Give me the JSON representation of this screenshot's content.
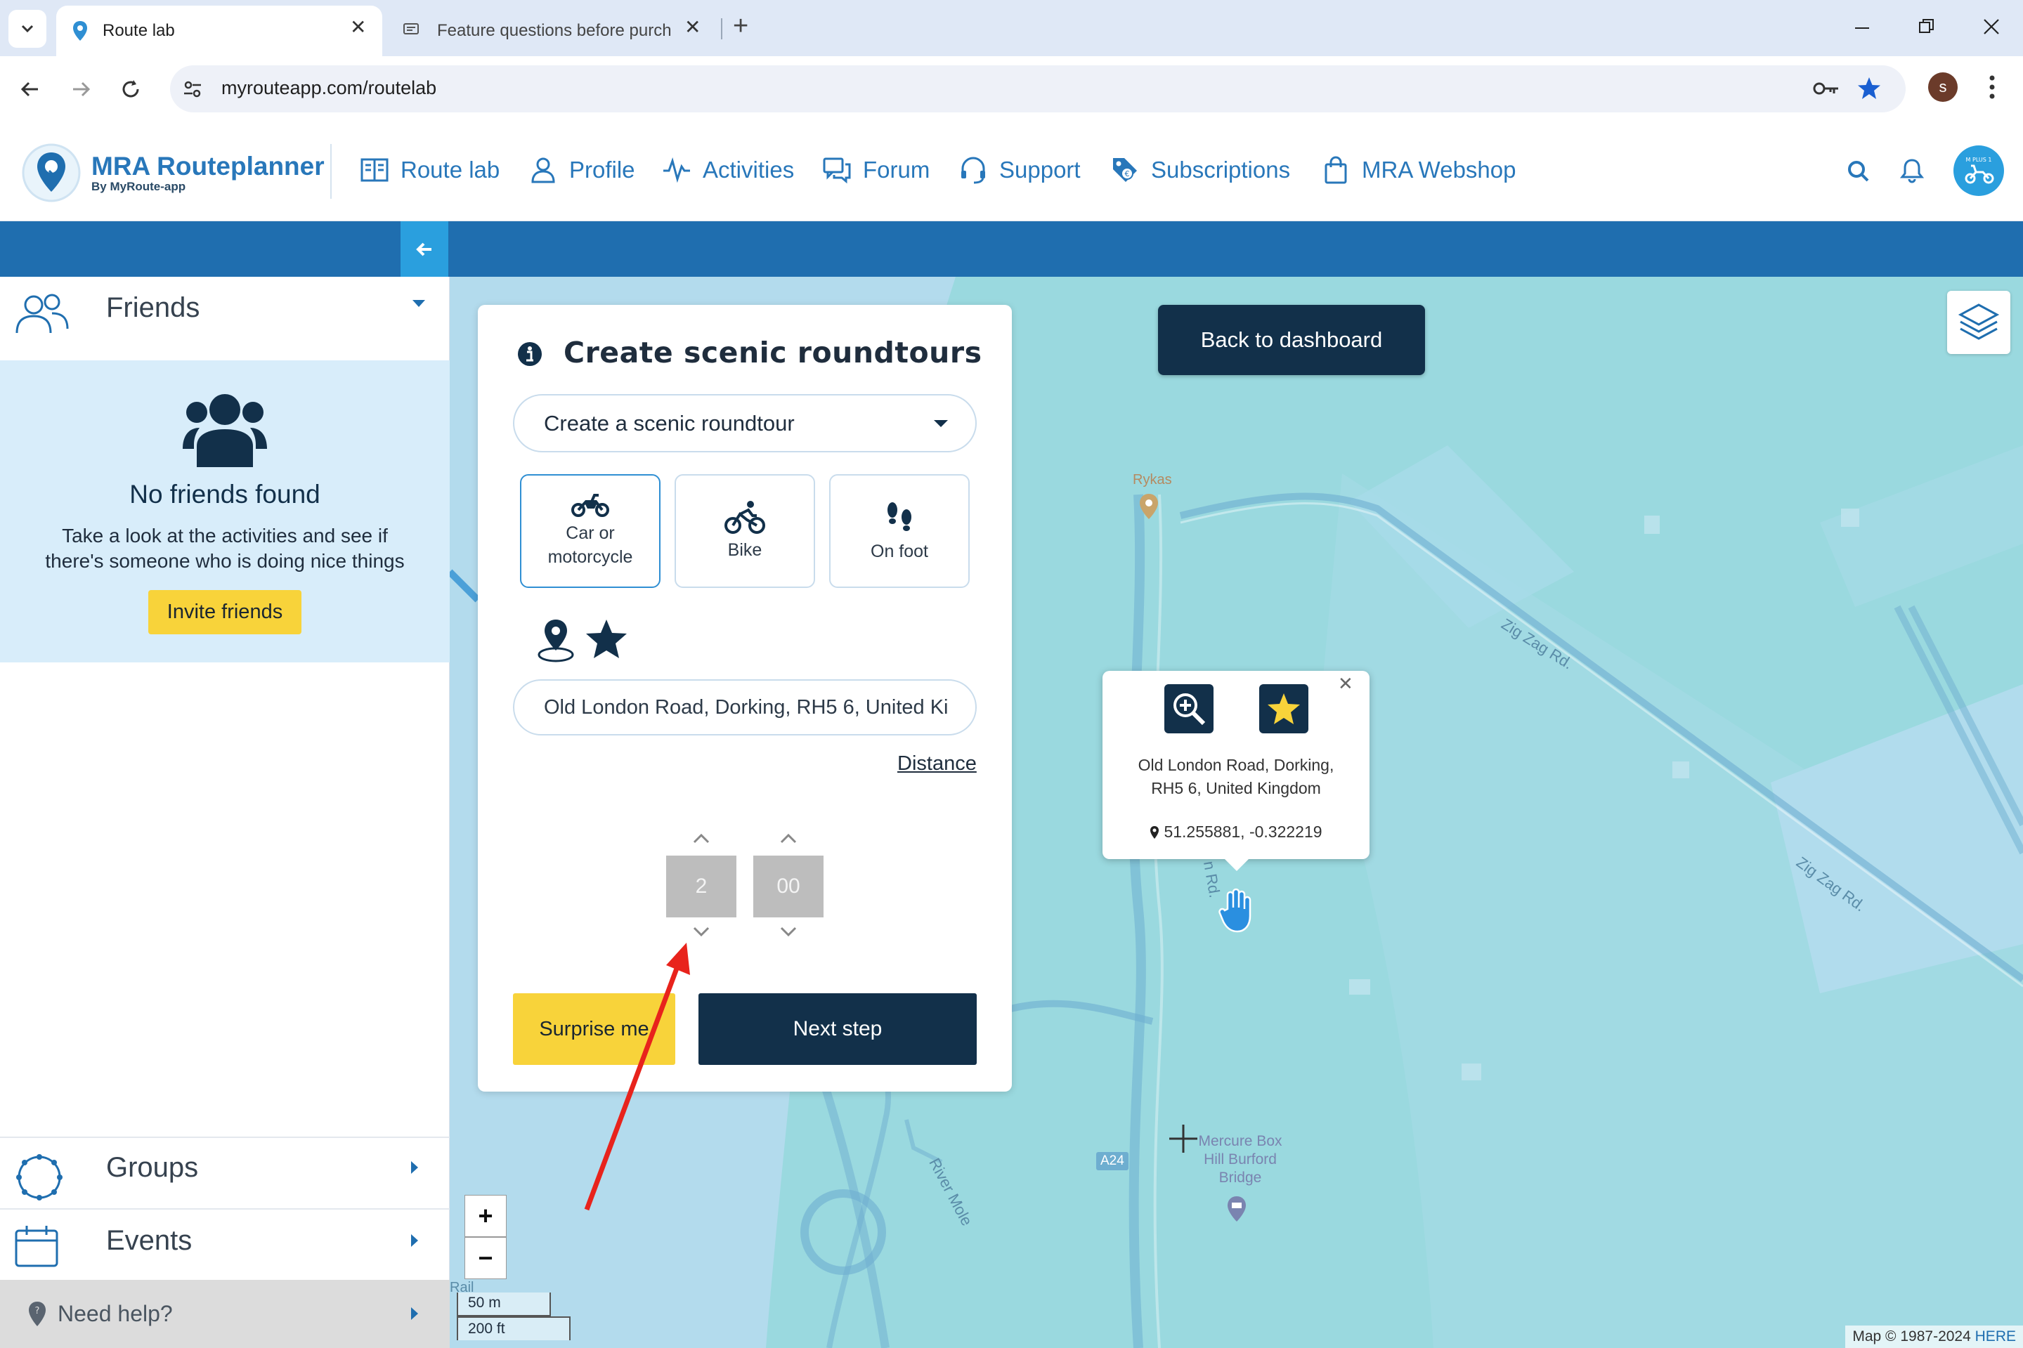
{
  "browser": {
    "tabs": [
      {
        "title": "Route lab",
        "icon": "map-pin-icon"
      },
      {
        "title": "Feature questions before purch",
        "icon": "forum-icon"
      }
    ],
    "url": "myrouteapp.com/routelab",
    "profile_initial": "s"
  },
  "nav": {
    "logo_title": "MRA Routeplanner",
    "logo_sub": "By MyRoute-app",
    "items": [
      {
        "label": "Route lab",
        "icon": "book-icon"
      },
      {
        "label": "Profile",
        "icon": "user-icon"
      },
      {
        "label": "Activities",
        "icon": "pulse-icon"
      },
      {
        "label": "Forum",
        "icon": "chat-icon"
      },
      {
        "label": "Support",
        "icon": "headset-icon"
      },
      {
        "label": "Subscriptions",
        "icon": "tag-icon"
      },
      {
        "label": "MRA Webshop",
        "icon": "bag-icon"
      }
    ]
  },
  "sidebar": {
    "friends_title": "Friends",
    "no_friends_title": "No friends found",
    "no_friends_text_1": "Take a look at the activities and see if",
    "no_friends_text_2": "there's someone who is doing nice things",
    "invite_label": "Invite friends",
    "groups_title": "Groups",
    "events_title": "Events",
    "help_label": "Need help?"
  },
  "panel": {
    "title": "Create scenic roundtours",
    "select_value": "Create a scenic roundtour",
    "modes": [
      {
        "line1": "Car or",
        "line2": "motorcycle",
        "active": true
      },
      {
        "line1": "Bike",
        "line2": "",
        "active": false
      },
      {
        "line1": "On foot",
        "line2": "",
        "active": false
      }
    ],
    "address_value": "Old London Road, Dorking, RH5 6, United Ki",
    "distance_label": "Distance",
    "hours": "2",
    "minutes": "00",
    "surprise_label": "Surprise me",
    "next_label": "Next step"
  },
  "map": {
    "back_label": "Back to dashboard",
    "popup_address_1": "Old London Road, Dorking,",
    "popup_address_2": "RH5 6, United Kingdom",
    "popup_coords": "51.255881, -0.322219",
    "labels": {
      "rykas": "Rykas",
      "zigzag1": "Zig Zag Rd.",
      "zigzag2": "Zig Zag Rd.",
      "road_frag": "n Rd.",
      "river": "River Mole",
      "a24": "A24",
      "hotel1": "Mercure Box",
      "hotel2": "Hill Burford",
      "hotel3": "Bridge",
      "rail": "Rail"
    },
    "scale_m": "50 m",
    "scale_ft": "200 ft",
    "attribution": "Map © 1987-2024",
    "attribution_link": "HERE",
    "zoom_in": "+",
    "zoom_out": "−"
  },
  "colors": {
    "brand_blue": "#1f6eaf",
    "nav_text": "#2877ba",
    "accent_yellow": "#f8d33a",
    "dark_navy": "#12304a",
    "map_water": "#9ad9df"
  }
}
